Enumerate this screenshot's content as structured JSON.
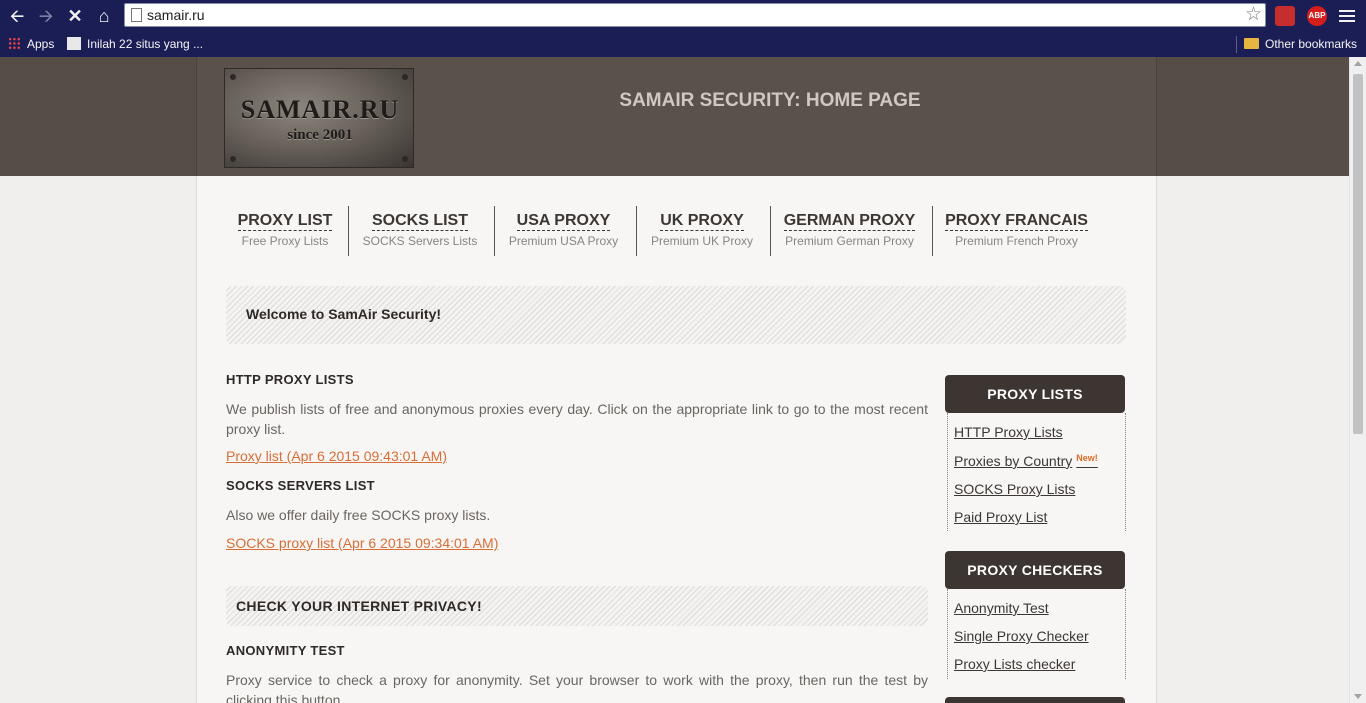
{
  "browser": {
    "url": "samair.ru",
    "bookmarks": {
      "apps": "Apps",
      "item1": "Inilah 22 situs yang ...",
      "other": "Other bookmarks"
    },
    "ext_labels": {
      "abp": "ABP"
    }
  },
  "header": {
    "logo_title": "SAMAIR.RU",
    "logo_sub": "since 2001",
    "title": "SAMAIR SECURITY: HOME PAGE"
  },
  "nav": [
    {
      "title": "PROXY LIST",
      "sub": "Free Proxy Lists"
    },
    {
      "title": "SOCKS LIST",
      "sub": "SOCKS Servers Lists"
    },
    {
      "title": "USA PROXY",
      "sub": "Premium USA Proxy"
    },
    {
      "title": "UK PROXY",
      "sub": "Premium UK Proxy"
    },
    {
      "title": "GERMAN PROXY",
      "sub": "Premium German Proxy"
    },
    {
      "title": "PROXY FRANCAIS",
      "sub": "Premium French Proxy"
    }
  ],
  "welcome": "Welcome to SamAir Security!",
  "main": {
    "http_heading": "HTTP PROXY LISTS",
    "http_text": "We publish lists of free and anonymous proxies every day. Click on the appropriate link to go to the most recent proxy list.",
    "http_link": "Proxy list (Apr 6 2015 09:43:01 AM)",
    "socks_heading": "SOCKS SERVERS LIST",
    "socks_text": "Also we offer daily free SOCKS proxy lists.",
    "socks_link": "SOCKS proxy list (Apr 6 2015 09:34:01 AM)",
    "privacy_heading": "CHECK YOUR INTERNET PRIVACY!",
    "anon_heading": "ANONYMITY TEST",
    "anon_text": "Proxy service to check a proxy for anonymity. Set your browser to work with the proxy, then run the test by clicking this button."
  },
  "sidebar": {
    "lists_heading": "PROXY LISTS",
    "lists": [
      "HTTP Proxy Lists",
      "Proxies by Country",
      "SOCKS Proxy Lists",
      "Paid Proxy List"
    ],
    "new_badge": "New!",
    "checkers_heading": "PROXY CHECKERS",
    "checkers": [
      "Anonymity Test",
      "Single Proxy Checker",
      "Proxy Lists checker"
    ]
  },
  "colors": {
    "chrome": "#1b1e55",
    "header_bg": "#564d47",
    "link": "#d86e36",
    "sidebar_head": "#3d3531"
  }
}
